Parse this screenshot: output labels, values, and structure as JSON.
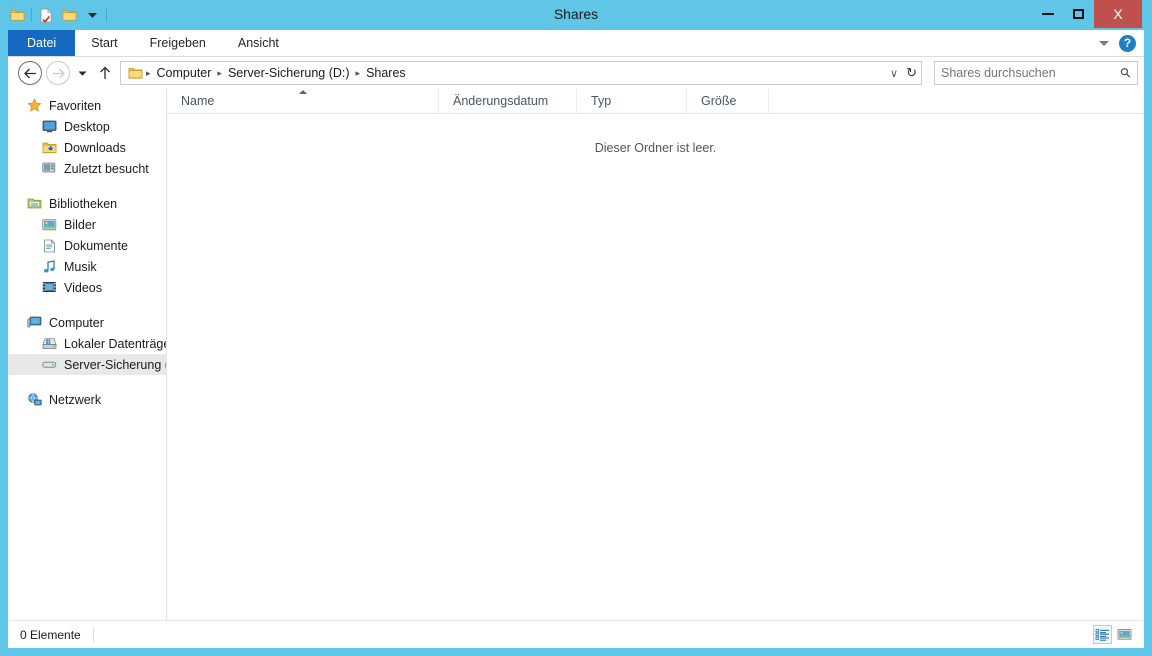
{
  "window": {
    "title": "Shares",
    "accent_blue": "#5fc6e8",
    "file_tab_blue": "#1569c0",
    "close_red": "#c0504d",
    "controls": {
      "minimize_label": "Minimieren",
      "maximize_label": "Maximieren",
      "close_label": "X"
    }
  },
  "quick_access": {
    "items": [
      {
        "icon": "folder-icon",
        "label": "Ordner"
      },
      {
        "icon": "properties-icon",
        "label": "Eigenschaften"
      },
      {
        "icon": "new-folder-icon",
        "label": "Neuer Ordner"
      },
      {
        "icon": "chevron-down-icon",
        "label": "Anpassen"
      }
    ]
  },
  "ribbon": {
    "tabs": [
      {
        "label": "Datei",
        "active": true
      },
      {
        "label": "Start",
        "active": false
      },
      {
        "label": "Freigeben",
        "active": false
      },
      {
        "label": "Ansicht",
        "active": false
      }
    ],
    "expand_icon": "chevron-down-icon",
    "help_label": "?"
  },
  "navbar": {
    "back_label": "←",
    "forward_label": "→",
    "history_label": "▾",
    "up_label": "↑",
    "breadcrumb": {
      "folder_icon": "folder-icon",
      "segments": [
        "Computer",
        "Server-Sicherung (D:)",
        "Shares"
      ],
      "separator": "▸"
    },
    "dropdown_label": "∨",
    "refresh_label": "↻"
  },
  "search": {
    "placeholder": "Shares durchsuchen",
    "icon": "search-icon"
  },
  "sidebar": {
    "groups": [
      {
        "root": {
          "label": "Favoriten",
          "icon": "star-icon"
        },
        "items": [
          {
            "label": "Desktop",
            "icon": "desktop-icon"
          },
          {
            "label": "Downloads",
            "icon": "downloads-icon"
          },
          {
            "label": "Zuletzt besucht",
            "icon": "recent-icon"
          }
        ]
      },
      {
        "root": {
          "label": "Bibliotheken",
          "icon": "libraries-icon"
        },
        "items": [
          {
            "label": "Bilder",
            "icon": "pictures-icon"
          },
          {
            "label": "Dokumente",
            "icon": "documents-icon"
          },
          {
            "label": "Musik",
            "icon": "music-icon"
          },
          {
            "label": "Videos",
            "icon": "videos-icon"
          }
        ]
      },
      {
        "root": {
          "label": "Computer",
          "icon": "computer-icon"
        },
        "items": [
          {
            "label": "Lokaler Datenträger",
            "icon": "local-disk-icon",
            "selected": false
          },
          {
            "label": "Server-Sicherung (D:",
            "icon": "drive-icon",
            "selected": true
          }
        ]
      },
      {
        "root": {
          "label": "Netzwerk",
          "icon": "network-icon"
        },
        "items": []
      }
    ]
  },
  "file_list": {
    "columns": [
      {
        "label": "Name",
        "sorted": "asc"
      },
      {
        "label": "Änderungsdatum",
        "sorted": ""
      },
      {
        "label": "Typ",
        "sorted": ""
      },
      {
        "label": "Größe",
        "sorted": ""
      }
    ],
    "rows": [],
    "empty_message": "Dieser Ordner ist leer."
  },
  "statusbar": {
    "item_count": "0 Elemente",
    "views": [
      {
        "name": "details-view",
        "active": true
      },
      {
        "name": "large-icons-view",
        "active": false
      }
    ]
  }
}
